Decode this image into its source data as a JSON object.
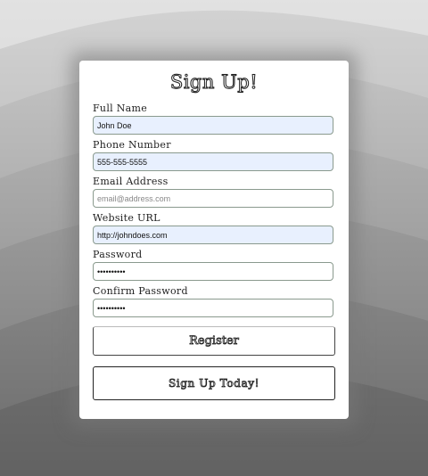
{
  "form": {
    "title": "Sign Up!",
    "fields": {
      "full_name": {
        "label": "Full Name",
        "value": "John Doe",
        "placeholder": ""
      },
      "phone": {
        "label": "Phone Number",
        "value": "555-555-5555",
        "placeholder": ""
      },
      "email": {
        "label": "Email Address",
        "value": "",
        "placeholder": "email@address.com"
      },
      "website": {
        "label": "Website URL",
        "value": "http://johndoes.com",
        "placeholder": ""
      },
      "password": {
        "label": "Password",
        "value": "••••••••••"
      },
      "confirm_password": {
        "label": "Confirm Password",
        "value": "••••••••••"
      }
    },
    "register_label": "Register",
    "signup_label": "Sign Up Today!"
  },
  "colors": {
    "filled_field_bg": "#e8f0fe",
    "card_bg": "#ffffff"
  }
}
